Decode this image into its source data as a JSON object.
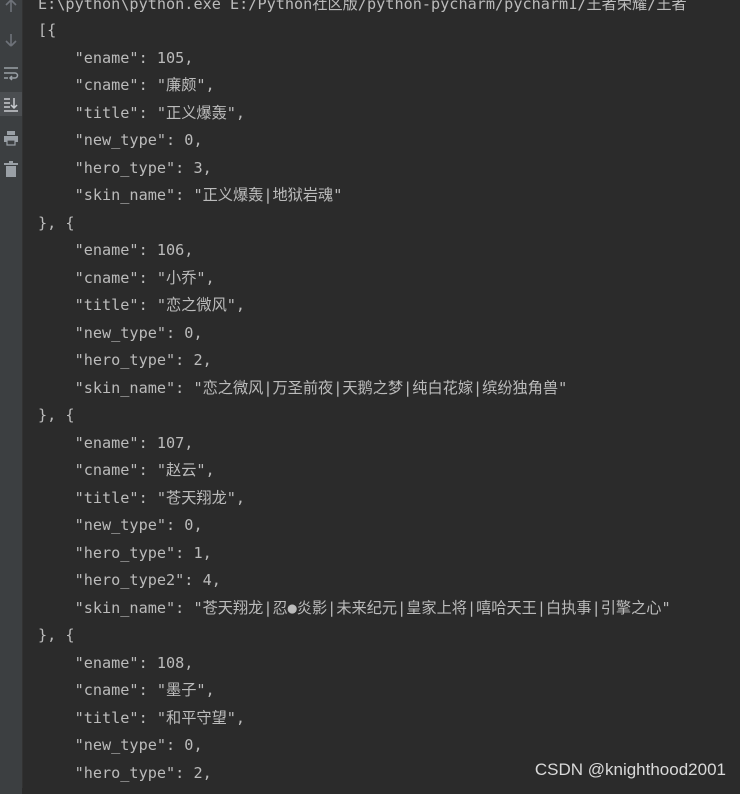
{
  "console": {
    "path_line": "E:\\python\\python.exe E:/Python社区版/python-pycharm/pycharm1/王者荣耀/王者",
    "lines": [
      "[{",
      "    \"ename\": 105,",
      "    \"cname\": \"廉颇\",",
      "    \"title\": \"正义爆轰\",",
      "    \"new_type\": 0,",
      "    \"hero_type\": 3,",
      "    \"skin_name\": \"正义爆轰|地狱岩魂\"",
      "}, {",
      "    \"ename\": 106,",
      "    \"cname\": \"小乔\",",
      "    \"title\": \"恋之微风\",",
      "    \"new_type\": 0,",
      "    \"hero_type\": 2,",
      "    \"skin_name\": \"恋之微风|万圣前夜|天鹅之梦|纯白花嫁|缤纷独角兽\"",
      "}, {",
      "    \"ename\": 107,",
      "    \"cname\": \"赵云\",",
      "    \"title\": \"苍天翔龙\",",
      "    \"new_type\": 0,",
      "    \"hero_type\": 1,",
      "    \"hero_type2\": 4,",
      "    \"skin_name\": \"苍天翔龙|忍●炎影|未来纪元|皇家上将|嘻哈天王|白执事|引擎之心\"",
      "}, {",
      "    \"ename\": 108,",
      "    \"cname\": \"墨子\",",
      "    \"title\": \"和平守望\",",
      "    \"new_type\": 0,",
      "    \"hero_type\": 2,"
    ]
  },
  "gutter": {
    "icons": [
      "up-arrow-icon",
      "down-arrow-icon",
      "soft-wrap-icon",
      "scroll-to-end-icon",
      "print-icon",
      "trash-icon"
    ]
  },
  "watermark": "CSDN @knighthood2001",
  "colors": {
    "background": "#2b2b2b",
    "gutter": "#3c3f41",
    "text": "#bbbbbb"
  }
}
